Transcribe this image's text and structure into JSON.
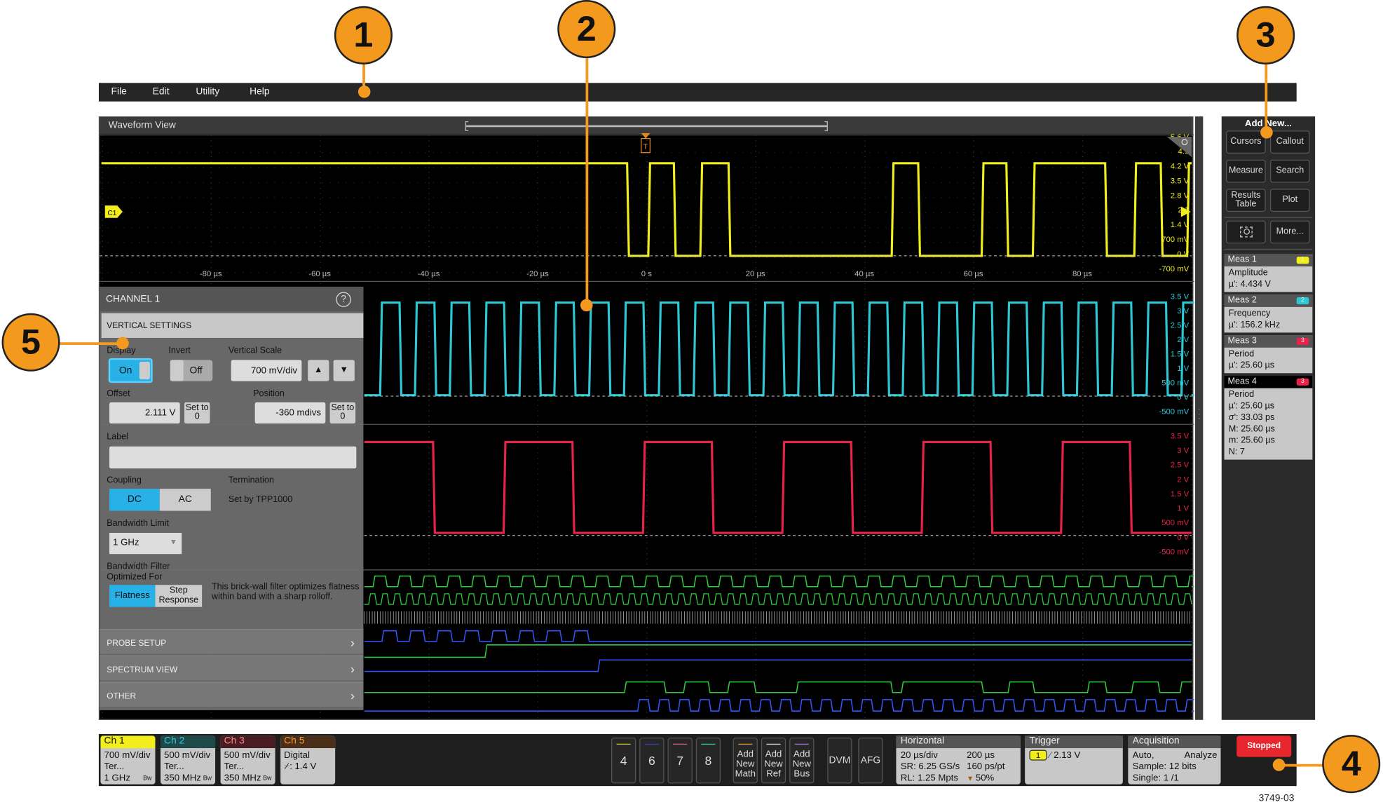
{
  "menu": [
    "File",
    "Edit",
    "Utility",
    "Help"
  ],
  "waveform_view": {
    "title": "Waveform View",
    "ch1_marker": "C1",
    "trigger_marker": "T",
    "time_ticks": [
      "-80 µs",
      "-60 µs",
      "-40 µs",
      "-20 µs",
      "0 s",
      "20 µs",
      "40 µs",
      "60 µs",
      "80 µs"
    ],
    "ch1_scale": [
      "5.6 V",
      "4.9",
      "4.2 V",
      "3.5 V",
      "2.8 V",
      "2.1",
      "1.4 V",
      "700 mV",
      "0 V",
      "-700 mV"
    ],
    "ch2_scale": [
      "3.5 V",
      "3 V",
      "2.5 V",
      "2 V",
      "1.5 V",
      "1 V",
      "500 mV",
      "0 V",
      "-500 mV"
    ],
    "ch3_scale": [
      "3.5 V",
      "3 V",
      "2.5 V",
      "2 V",
      "1.5 V",
      "1 V",
      "500 mV",
      "0 V",
      "-500 mV"
    ],
    "colors": {
      "ch1": "#f2ee1c",
      "ch2": "#2ec8d4",
      "ch3": "#e8234a",
      "digital_green": "#2ecc40",
      "digital_blue": "#3355ff"
    }
  },
  "right_panel": {
    "title": "Add New...",
    "buttons": [
      "Cursors",
      "Callout",
      "Measure",
      "Search",
      "Results Table",
      "Plot",
      "More..."
    ],
    "zoom_icon": "zoom-box-icon",
    "measurements": [
      {
        "name": "Meas 1",
        "badge": "1",
        "badge_color": "#f2ee1c",
        "lines": [
          "Amplitude",
          "µ': 4.434 V"
        ]
      },
      {
        "name": "Meas 2",
        "badge": "2",
        "badge_color": "#2ec8d4",
        "lines": [
          "Frequency",
          "µ': 156.2 kHz"
        ]
      },
      {
        "name": "Meas 3",
        "badge": "3",
        "badge_color": "#e8234a",
        "lines": [
          "Period",
          "µ': 25.60 µs"
        ]
      },
      {
        "name": "Meas 4",
        "badge": "3",
        "badge_color": "#e8234a",
        "lines": [
          "Period",
          "µ': 25.60 µs",
          "σ': 33.03 ps",
          "M: 25.60 µs",
          "m: 25.60 µs",
          "N: 7"
        ]
      }
    ]
  },
  "channel_panel": {
    "title": "CHANNEL 1",
    "section": "VERTICAL SETTINGS",
    "display_label": "Display",
    "display_value": "On",
    "invert_label": "Invert",
    "invert_value": "Off",
    "vscale_label": "Vertical Scale",
    "vscale_value": "700 mV/div",
    "offset_label": "Offset",
    "offset_value": "2.111 V",
    "position_label": "Position",
    "position_value": "-360 mdivs",
    "set_to_0": "Set to 0",
    "label_label": "Label",
    "label_value": "",
    "coupling_label": "Coupling",
    "coupling_options": [
      "DC",
      "AC"
    ],
    "termination_label": "Termination",
    "termination_value": "Set by TPP1000",
    "bw_label": "Bandwidth Limit",
    "bw_value": "1 GHz",
    "bwf_label": "Bandwidth Filter Optimized For",
    "bwf_options": [
      "Flatness",
      "Step Response"
    ],
    "bwf_desc": "This brick-wall filter optimizes flatness within band with a sharp rolloff.",
    "sections": [
      "PROBE SETUP",
      "SPECTRUM VIEW",
      "OTHER"
    ]
  },
  "bottom_bar": {
    "channels": [
      {
        "name": "Ch 1",
        "lines": [
          "700 mV/div",
          "Ter...",
          "1 GHz"
        ],
        "color": "#f2ee1c"
      },
      {
        "name": "Ch 2",
        "lines": [
          "500 mV/div",
          "Ter...",
          "350 MHz"
        ],
        "color": "#1d4a48"
      },
      {
        "name": "Ch 3",
        "lines": [
          "500 mV/div",
          "Ter...",
          "350 MHz"
        ],
        "color": "#4a1d24"
      },
      {
        "name": "Ch 5",
        "lines": [
          "Digital",
          "⌿: 1.4 V",
          ""
        ],
        "color": "#4a3018"
      }
    ],
    "bw_badge": "Bw",
    "inactive_channels": [
      "4",
      "6",
      "7",
      "8"
    ],
    "add_buttons": [
      "Add New Math",
      "Add New Ref",
      "Add New Bus"
    ],
    "tools": [
      "DVM",
      "AFG"
    ],
    "horizontal": {
      "title": "Horizontal",
      "lines": [
        [
          "20 µs/div",
          "200 µs"
        ],
        [
          "SR: 6.25 GS/s",
          "160 ps/pt"
        ],
        [
          "RL: 1.25 Mpts",
          "50%"
        ]
      ]
    },
    "trigger": {
      "title": "Trigger",
      "source": "1",
      "level": "2.13 V"
    },
    "acquisition": {
      "title": "Acquisition",
      "lines": [
        [
          "Auto,",
          "Analyze"
        ],
        [
          "Sample: 12 bits",
          ""
        ],
        [
          "Single: 1 /1",
          ""
        ]
      ]
    },
    "run_status": "Stopped"
  },
  "callouts": [
    "1",
    "2",
    "3",
    "4",
    "5"
  ],
  "figure_id": "3749-03"
}
